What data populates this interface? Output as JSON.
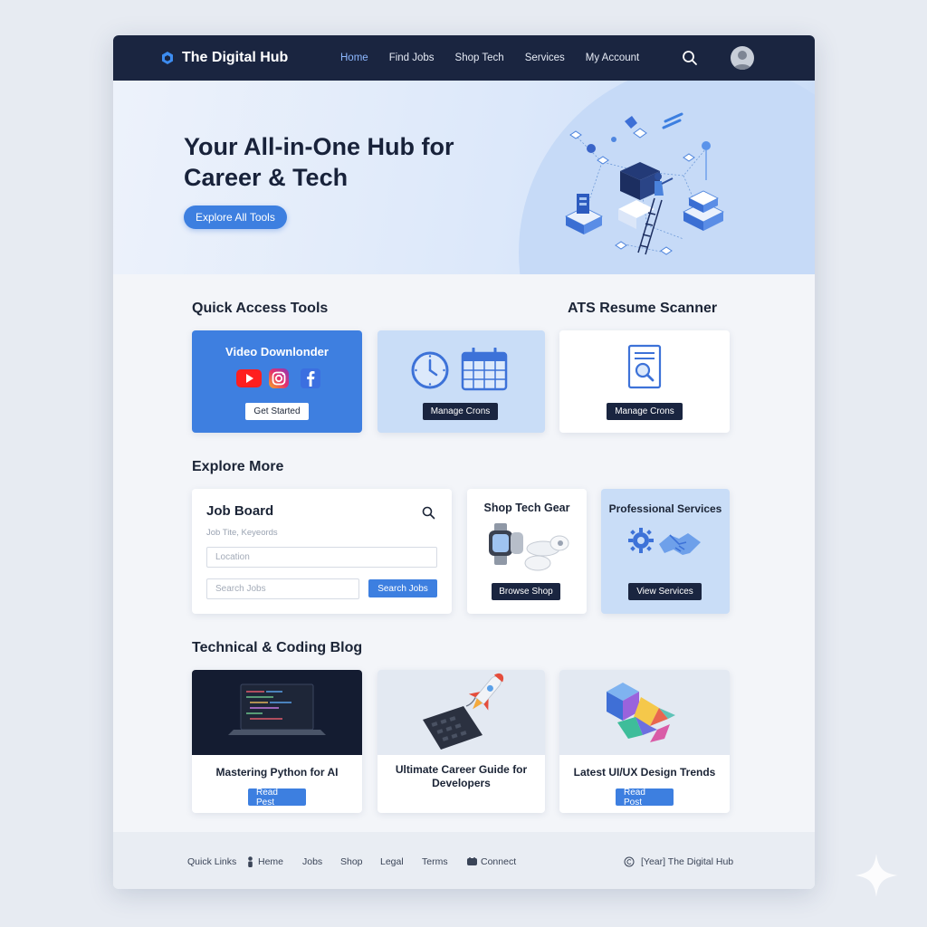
{
  "nav": {
    "brand": "The Digital Hub",
    "links": [
      "Home",
      "Find Jobs",
      "Shop Tech",
      "Services",
      "My Account"
    ]
  },
  "hero": {
    "title": "Your All-in-One Hub for Career & Tech",
    "cta": "Explore All Tools"
  },
  "quick_access": {
    "heading": "Quick Access Tools",
    "ats_heading": "ATS Resume Scanner",
    "video": {
      "title": "Video Downlonder",
      "button": "Get Started"
    },
    "crons": {
      "button": "Manage Crons"
    },
    "ats": {
      "button": "Manage Crons"
    }
  },
  "explore": {
    "heading": "Explore More",
    "job_board": {
      "title": "Job Board",
      "keywords_placeholder": "Job Tite, Keyeords",
      "location_placeholder": "Location",
      "search_placeholder": "Search Jobs",
      "button": "Search Jobs"
    },
    "shop": {
      "title": "Shop Tech Gear",
      "button": "Browse Shop"
    },
    "services": {
      "title": "Professional Services",
      "button": "View Services"
    }
  },
  "blog": {
    "heading": "Technical & Coding Blog",
    "posts": [
      {
        "title": "Mastering Python for AI",
        "button": "Read Pest"
      },
      {
        "title": "Ultimate Career Guide for Developers"
      },
      {
        "title": "Latest UI/UX Design Trends",
        "button": "Read Post"
      }
    ]
  },
  "footer": {
    "quick_links": "Quick Links",
    "home": "Heme",
    "jobs": "Jobs",
    "shop": "Shop",
    "legal": "Legal",
    "terms": "Terms",
    "connect": "Connect",
    "copyright": "[Year] The Digital Hub"
  },
  "colors": {
    "navy": "#1a2540",
    "accent": "#3d7fe0",
    "light_blue": "#c9ddf7"
  }
}
